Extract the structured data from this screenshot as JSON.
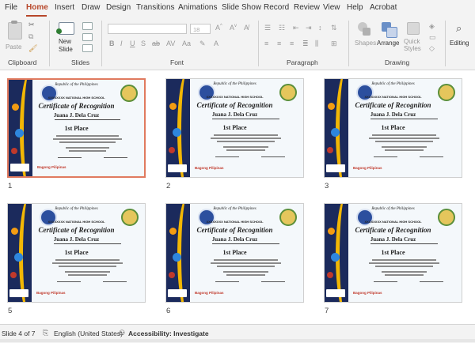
{
  "menu": {
    "tabs": [
      {
        "label": "File",
        "active": false
      },
      {
        "label": "Home",
        "active": true
      },
      {
        "label": "Insert",
        "active": false
      },
      {
        "label": "Draw",
        "active": false
      },
      {
        "label": "Design",
        "active": false
      },
      {
        "label": "Transitions",
        "active": false
      },
      {
        "label": "Animations",
        "active": false
      },
      {
        "label": "Slide Show",
        "active": false
      },
      {
        "label": "Record",
        "active": false
      },
      {
        "label": "Review",
        "active": false
      },
      {
        "label": "View",
        "active": false
      },
      {
        "label": "Help",
        "active": false
      },
      {
        "label": "Acrobat",
        "active": false
      }
    ],
    "accent": "#b7472a"
  },
  "ribbon": {
    "paste": "Paste",
    "new_slide": "New\nSlide",
    "font_size": "18",
    "shapes": "Shapes",
    "arrange": "Arrange",
    "quick_styles": "Quick\nStyles",
    "editing": "Editing",
    "groups": {
      "clipboard": "Clipboard",
      "slides": "Slides",
      "font": "Font",
      "paragraph": "Paragraph",
      "drawing": "Drawing"
    }
  },
  "slides": [
    {
      "number": "1",
      "selected": true
    },
    {
      "number": "2",
      "selected": false
    },
    {
      "number": "3",
      "selected": false
    },
    {
      "number": "5",
      "selected": false
    },
    {
      "number": "6",
      "selected": false
    },
    {
      "number": "7",
      "selected": false
    }
  ],
  "certificate": {
    "republic": "Republic of the Philippines",
    "school": "XXXXXXXX NATIONAL HIGH SCHOOL",
    "title": "Certificate of Recognition",
    "name": "Juana J. Dela Cruz",
    "place": "1st Place",
    "bagong": "Bagong Pilipinas"
  },
  "status": {
    "slide_count": "Slide 4 of 7",
    "language": "English (United States)",
    "accessibility": "Accessibility: Investigate"
  }
}
